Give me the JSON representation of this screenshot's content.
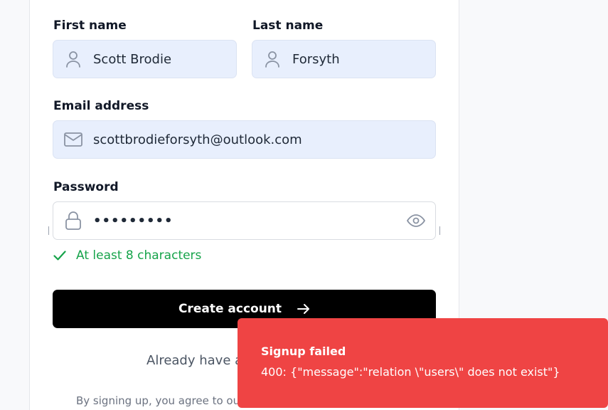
{
  "form": {
    "first_name": {
      "label": "First name",
      "value": "Scott Brodie",
      "icon": "user-icon"
    },
    "last_name": {
      "label": "Last name",
      "value": "Forsyth",
      "icon": "user-icon"
    },
    "email": {
      "label": "Email address",
      "value": "scottbrodieforsyth@outlook.com",
      "icon": "mail-icon"
    },
    "password": {
      "label": "Password",
      "value": "•••••••••",
      "icon": "lock-icon",
      "toggle_icon": "eye-icon"
    },
    "password_hint": {
      "text": "At least 8 characters",
      "status": "met",
      "color": "#16a34a"
    },
    "submit_label": "Create account",
    "login_prompt": "Already have an",
    "terms_text": "By signing up, you agree to our"
  },
  "toast": {
    "title": "Signup failed",
    "message": "400: {\"message\":\"relation \\\"users\\\" does not exist\"}",
    "color": "#ef4444"
  },
  "colors": {
    "filled_input_bg": "#e8effd",
    "primary_button": "#000000",
    "page_bg": "#f8f9fb"
  }
}
